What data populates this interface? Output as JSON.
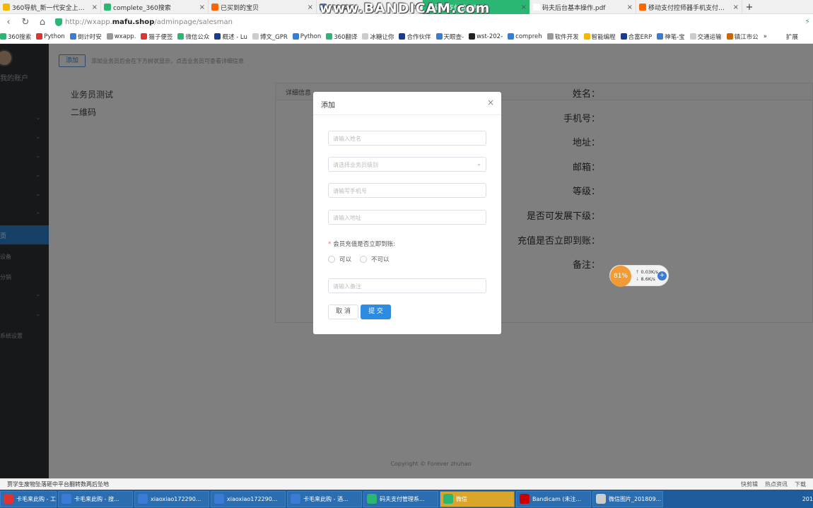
{
  "watermark": "www.BANDICAM.com",
  "tabs": [
    {
      "label": "360导航_新一代安全上网导航",
      "color": "#f5b800"
    },
    {
      "label": "complete_360搜索",
      "color": "#2bb673"
    },
    {
      "label": "已买到的宝贝",
      "color": "#ff6600"
    },
    {
      "label": "扑克模板",
      "color": "#3a7bd5"
    },
    {
      "label": "码夫支付管理系统",
      "color": "#2bb673",
      "active": true
    },
    {
      "label": "码夫后台基本操作.pdf",
      "color": "#ffffff"
    },
    {
      "label": "移动支付控师器手机支付扫码收",
      "color": "#ff6600"
    }
  ],
  "new_tab": "+",
  "address": {
    "scheme": "http://wxapp.",
    "host": "mafu.shop",
    "path": "/adminpage/salesman"
  },
  "bookmarks": [
    {
      "label": "360搜索",
      "color": "#2bb673"
    },
    {
      "label": "Python",
      "color": "#d33"
    },
    {
      "label": "倒计时安",
      "color": "#3a7bd5"
    },
    {
      "label": "wxapp.",
      "color": "#999"
    },
    {
      "label": "猫子便签",
      "color": "#d33"
    },
    {
      "label": "微信公众",
      "color": "#2bb673"
    },
    {
      "label": "概述 - Lu",
      "color": "#1a3c8c"
    },
    {
      "label": "博文_GPR",
      "color": "#ccc"
    },
    {
      "label": "Python",
      "color": "#3a7bd5"
    },
    {
      "label": "360翻译",
      "color": "#2bb673"
    },
    {
      "label": "冰糖让你",
      "color": "#ccc"
    },
    {
      "label": "合作伙伴",
      "color": "#1a3c8c"
    },
    {
      "label": "天眼查-",
      "color": "#3a7bd5"
    },
    {
      "label": "wst-202-",
      "color": "#222"
    },
    {
      "label": "compreh",
      "color": "#3a7bd5"
    },
    {
      "label": "软件开发",
      "color": "#999"
    },
    {
      "label": "智能编程",
      "color": "#f5b800"
    },
    {
      "label": "合富ERP",
      "color": "#1a3c8c"
    },
    {
      "label": "神笔-宝",
      "color": "#3a7bd5"
    },
    {
      "label": "交通运输",
      "color": "#ccc"
    },
    {
      "label": "镇江市公",
      "color": "#c60"
    }
  ],
  "bookmark_more": "»",
  "bookmark_ext": "扩展",
  "sidebar": {
    "account": "我的账户",
    "active_item": "页",
    "items": [
      "设备",
      "分销",
      "系统设置"
    ]
  },
  "content": {
    "add_button": "添加",
    "hint": "添加业务员后会在下方树状显示，点击业务员可查看详细信息",
    "left_list": [
      "业务员测试",
      "二维码"
    ],
    "panel_title": "详细信息",
    "fields": [
      "姓名：",
      "手机号：",
      "地址：",
      "邮箱：",
      "等级：",
      "是否可发展下级：",
      "充值是否立即到账：",
      "备注："
    ],
    "copyright": "Copyright © Forever zhuhao"
  },
  "modal": {
    "title": "添加",
    "close": "×",
    "name_placeholder": "请输入姓名",
    "level_placeholder": "请选择业务员级别",
    "phone_placeholder": "请输写手机号",
    "address_placeholder": "请输入地址",
    "recharge_label": "会员充值是否立即到账:",
    "radio_yes": "可以",
    "radio_no": "不可以",
    "remark_placeholder": "请输入备注",
    "cancel": "取 消",
    "submit": "提 交"
  },
  "net_widget": {
    "percent": "81%",
    "up": "0.03K/s",
    "down": "8.6K/s"
  },
  "statusbar": {
    "news": "贾学生废物坠落砸中平台翻转数两后坠地",
    "right_items": [
      "快剪辑",
      "热点资讯",
      "下载"
    ]
  },
  "taskbar": [
    {
      "label": "卡毛来此购 - 工...",
      "color": "#d33"
    },
    {
      "label": "卡毛来此购 - 搜...",
      "color": "#3a7bd5"
    },
    {
      "label": "xiaoxiao172290...",
      "color": "#3a7bd5"
    },
    {
      "label": "xiaoxiao172290...",
      "color": "#3a7bd5"
    },
    {
      "label": "卡毛来此购 - 酒...",
      "color": "#3a7bd5"
    },
    {
      "label": "码夫支付管理系...",
      "color": "#2bb673"
    },
    {
      "label": "微信",
      "color": "#2bb673",
      "highlight": true
    },
    {
      "label": "Bandicam (未注...",
      "color": "#c00"
    },
    {
      "label": "微信图片_201809...",
      "color": "#ccc"
    }
  ],
  "tray_year": "201"
}
